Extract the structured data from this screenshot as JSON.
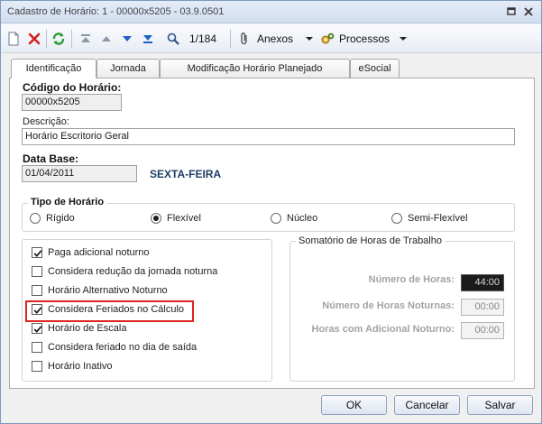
{
  "window": {
    "title": "Cadastro de Horário: 1 - 00000x5205 - 03.9.0501"
  },
  "toolbar": {
    "record_position": "1/184",
    "anexos_label": "Anexos",
    "processos_label": "Processos"
  },
  "tabs": [
    {
      "label": "Identificação",
      "active": true
    },
    {
      "label": "Jornada",
      "active": false
    },
    {
      "label": "Modificação Horário Planejado",
      "active": false
    },
    {
      "label": "eSocial",
      "active": false
    }
  ],
  "form": {
    "codigo_label": "Código do Horário:",
    "codigo_value": "00000x5205",
    "descricao_label": "Descrição:",
    "descricao_value": "Horário Escritorio Geral",
    "database_label": "Data Base:",
    "database_value": "01/04/2011",
    "weekday": "SEXTA-FEIRA"
  },
  "tipo_horario": {
    "title": "Tipo de Horário",
    "options": [
      {
        "label": "Rígido",
        "selected": false
      },
      {
        "label": "Flexível",
        "selected": true
      },
      {
        "label": "Núcleo",
        "selected": false
      },
      {
        "label": "Semi-Flexível",
        "selected": false
      }
    ]
  },
  "options": [
    {
      "label": "Paga adicional noturno",
      "checked": true
    },
    {
      "label": "Considera redução da jornada noturna",
      "checked": false
    },
    {
      "label": "Horário Alternativo Noturno",
      "checked": false
    },
    {
      "label": "Considera Feriados no Cálculo",
      "checked": true
    },
    {
      "label": "Horário de Escala",
      "checked": true
    },
    {
      "label": "Considera feriado no dia de saída",
      "checked": false
    },
    {
      "label": "Horário Inativo",
      "checked": false
    }
  ],
  "somatorio": {
    "title": "Somatório de Horas de Trabalho",
    "numero_horas_label": "Número de Horas:",
    "numero_horas_value": "44:00",
    "horas_noturnas_label": "Número de Horas Noturnas:",
    "horas_noturnas_value": "00:00",
    "adicional_noturno_label": "Horas com Adicional Noturno:",
    "adicional_noturno_value": "00:00"
  },
  "buttons": {
    "ok": "OK",
    "cancelar": "Cancelar",
    "salvar": "Salvar"
  },
  "colors": {
    "highlight_border": "#e02222",
    "window_border": "#7e99bd",
    "weekday_text": "#1f3d64"
  }
}
